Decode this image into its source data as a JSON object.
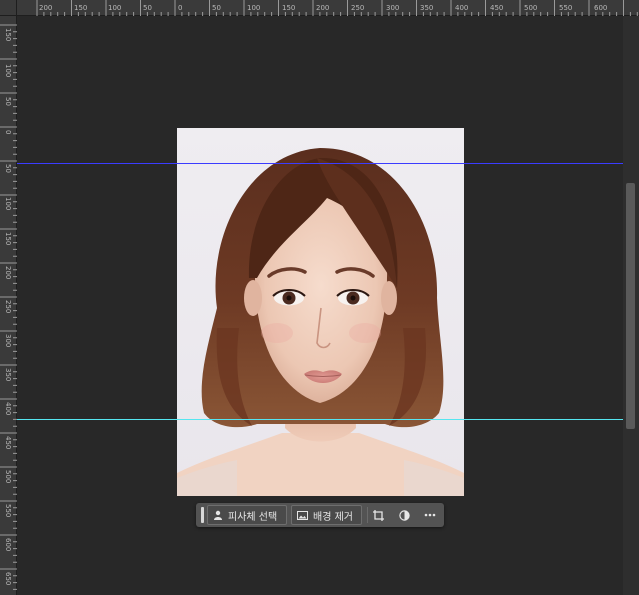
{
  "ruler_top_labels": [
    "200",
    "150",
    "100",
    "50",
    "0",
    "50",
    "100",
    "150",
    "200",
    "250",
    "300",
    "350",
    "400",
    "450",
    "500",
    "550",
    "600"
  ],
  "ruler_left_labels": [
    "150",
    "100",
    "50",
    "0",
    "50",
    "100",
    "150",
    "200",
    "250",
    "300",
    "350",
    "400",
    "450",
    "500",
    "550",
    "600",
    "650"
  ],
  "guides": {
    "blue_color": "#3b3cff",
    "cyan_color": "#56e6f0"
  },
  "taskbar": {
    "select_subject_label": "피사체 선택",
    "remove_background_label": "배경 제거",
    "icons": [
      "person-icon",
      "image-icon",
      "crop-transform-icon",
      "half-circle-adjust-icon",
      "more-icon"
    ]
  },
  "image": {
    "subject": "portrait-photo"
  }
}
